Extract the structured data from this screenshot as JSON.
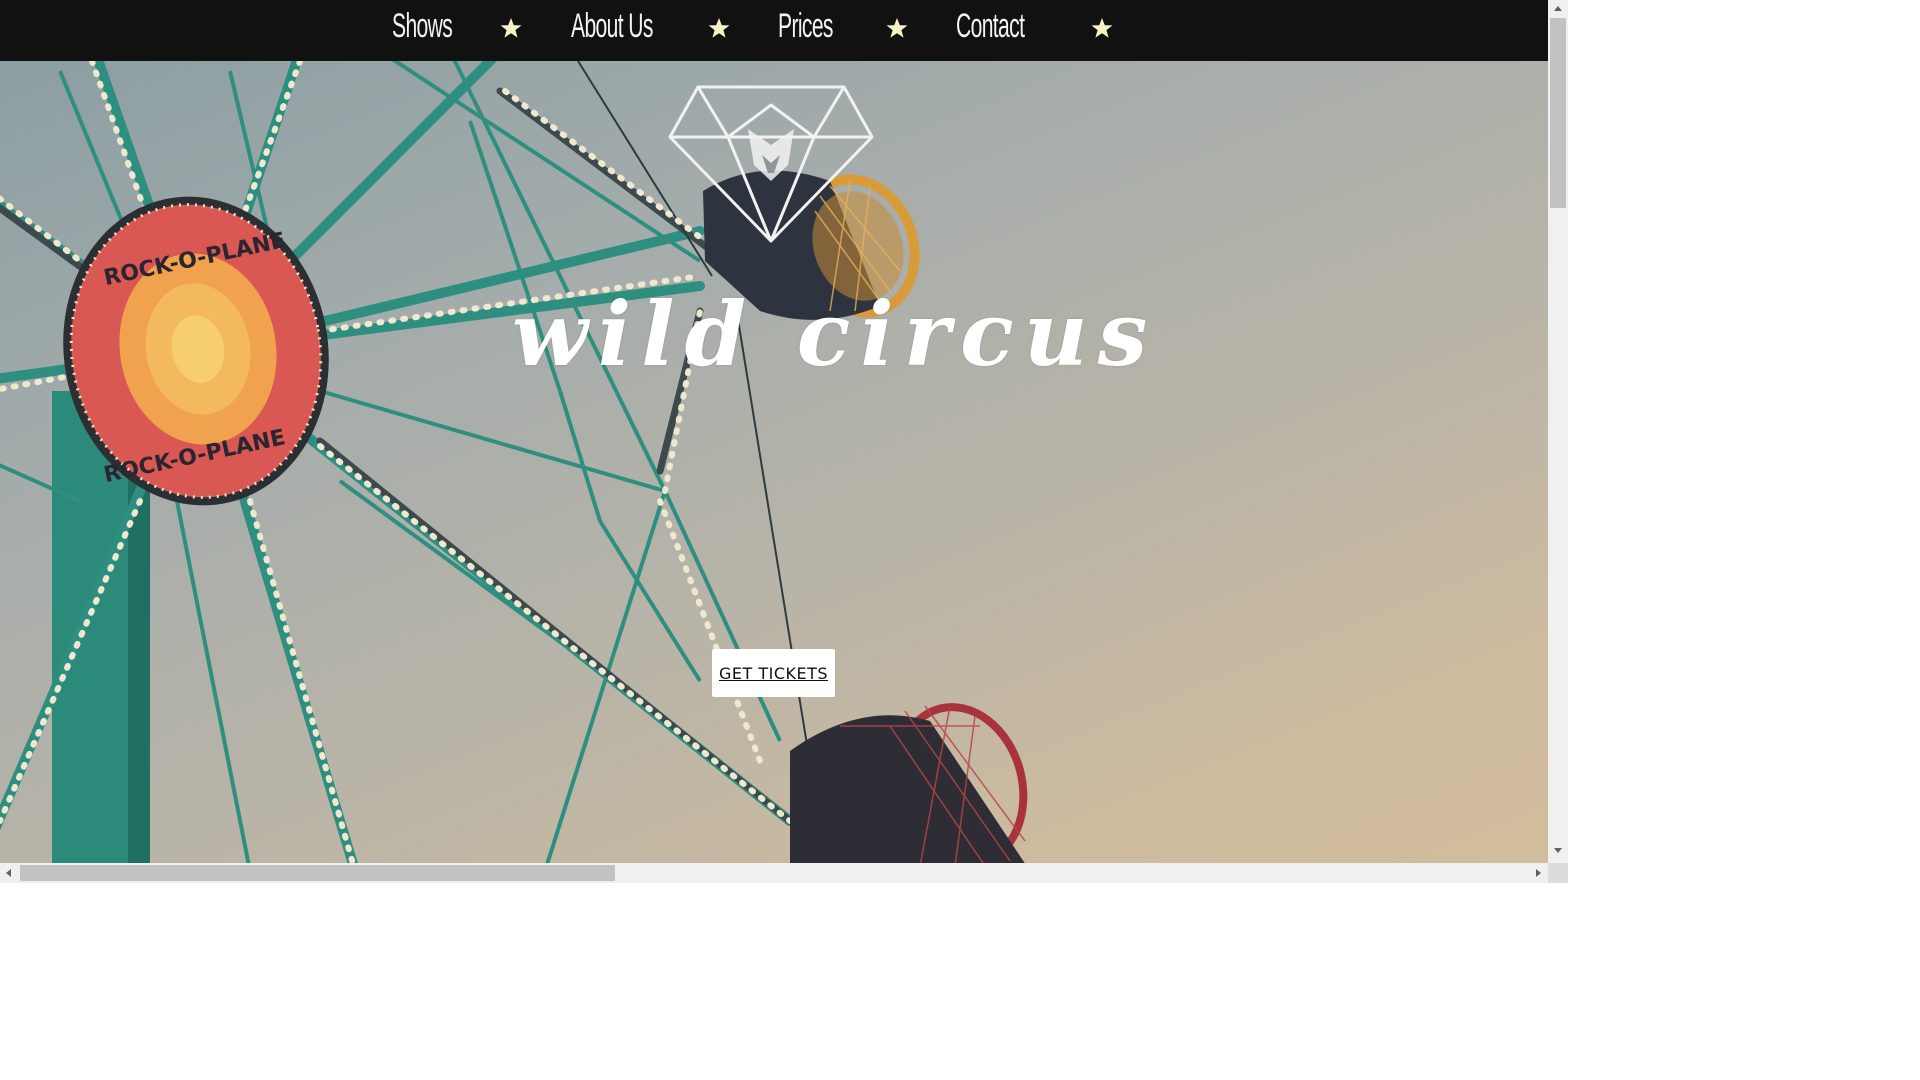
{
  "nav": {
    "items": [
      {
        "label": "Shows"
      },
      {
        "label": "About Us"
      },
      {
        "label": "Prices"
      },
      {
        "label": "Contact"
      }
    ],
    "star_color": "#f7f2c4",
    "background": "#111111"
  },
  "hero": {
    "title": "wild circus",
    "sign_text": "ROCK-O-PLANE",
    "cta_label": "GET TICKETS",
    "logo_icon": "diamond-lion-icon"
  },
  "colors": {
    "frame_teal": "#2e8f80",
    "bulb": "#eee6cc",
    "gondola_orange": "#d99a3a",
    "gondola_red": "#a8333a",
    "sign_red": "#de5a57",
    "sign_center": "#f2b45a"
  }
}
